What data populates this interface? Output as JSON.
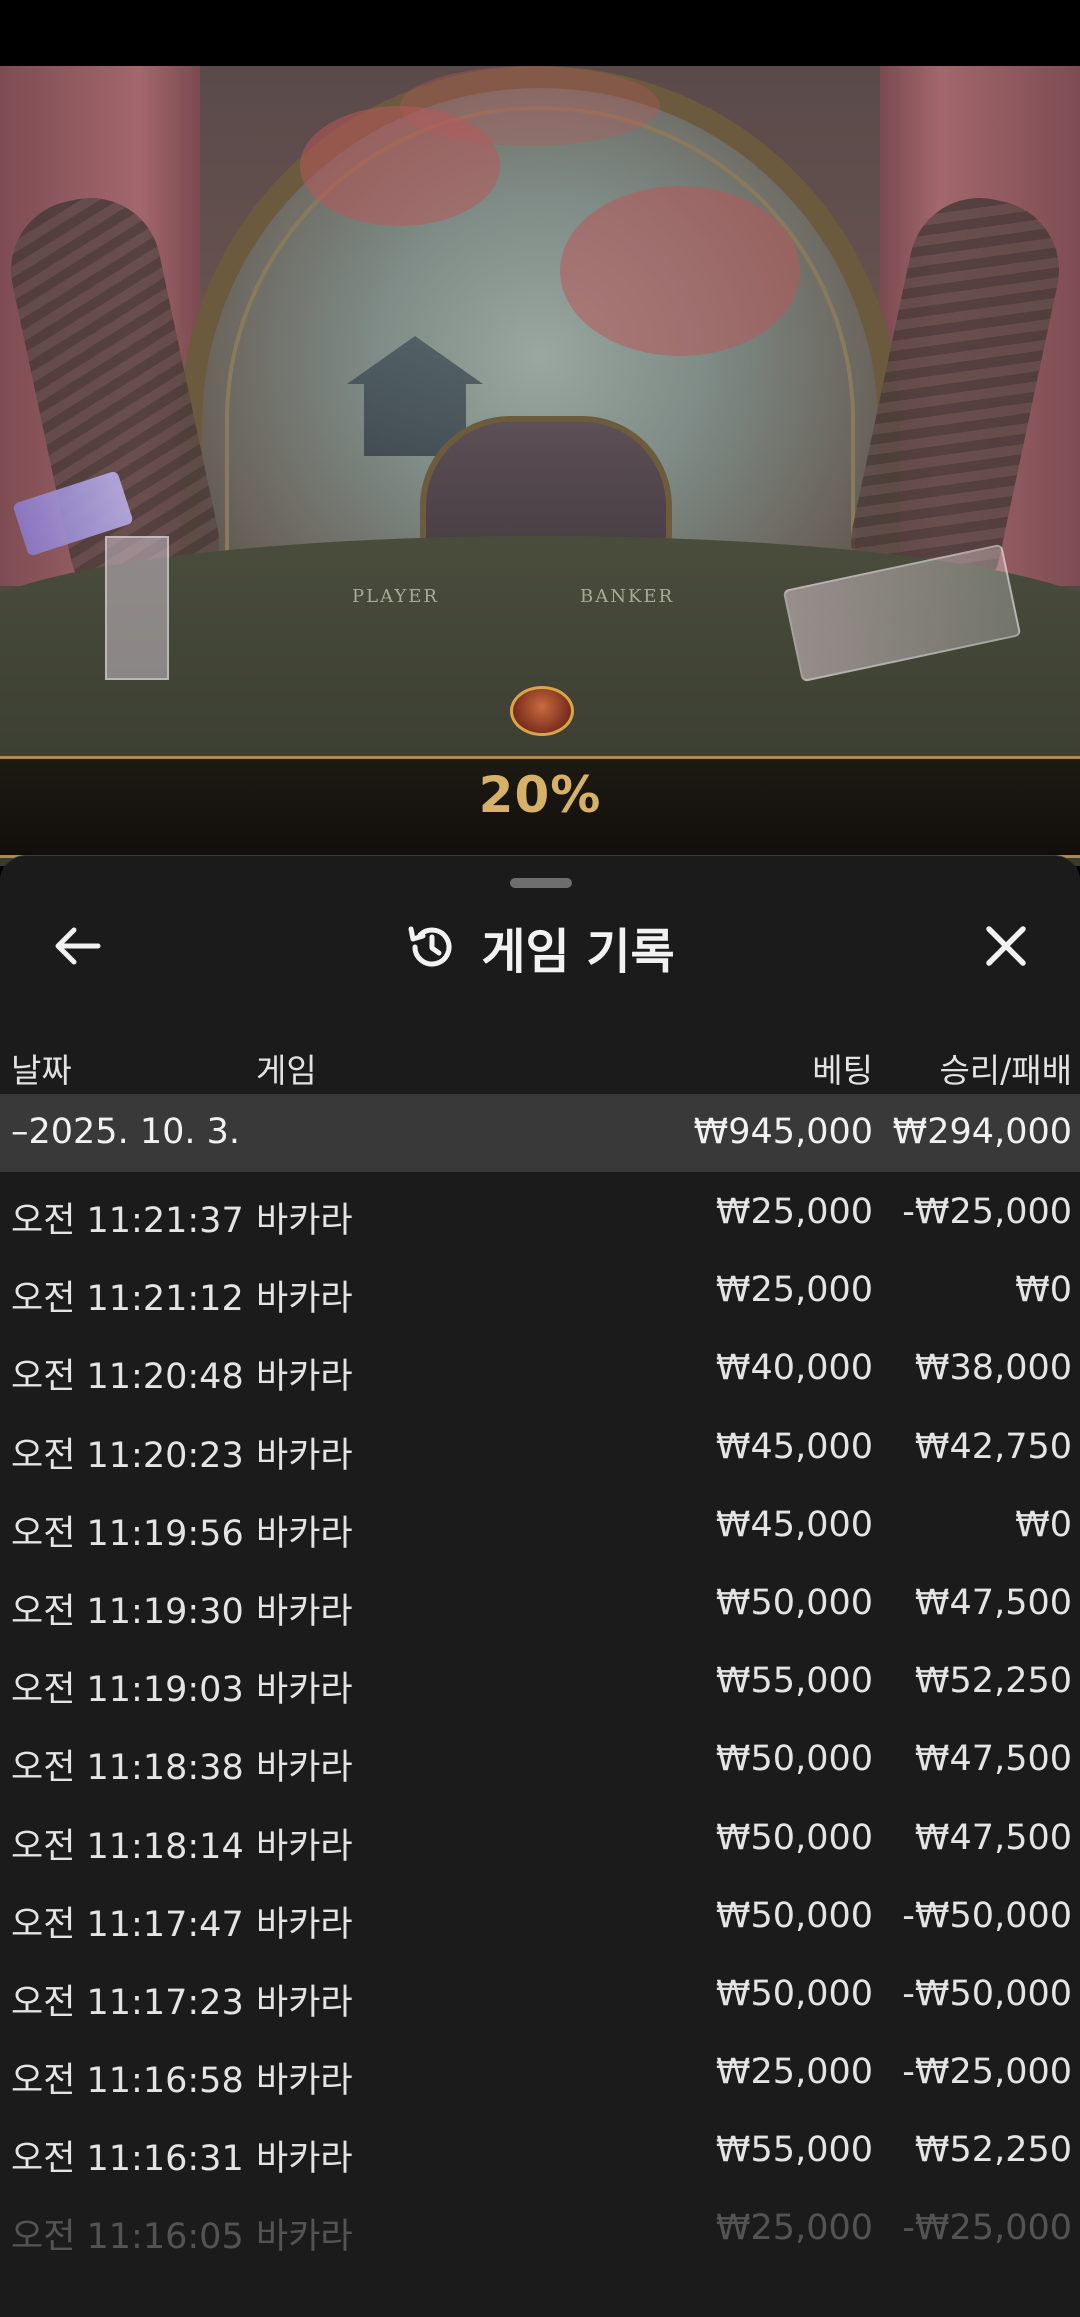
{
  "video": {
    "table_labels": [
      "PLAYER",
      "BANKER"
    ],
    "progress_text": "20%"
  },
  "sheet": {
    "title": "게임 기록",
    "columns": {
      "date": "날짜",
      "game": "게임",
      "bet": "베팅",
      "result": "승리/패배"
    },
    "group": {
      "date": "–2025. 10. 3.",
      "bet": "₩945,000",
      "result": "₩294,000"
    },
    "rows": [
      {
        "time": "오전 11:21:37",
        "game": "바카라",
        "bet": "₩25,000",
        "result": "-₩25,000"
      },
      {
        "time": "오전 11:21:12",
        "game": "바카라",
        "bet": "₩25,000",
        "result": "₩0"
      },
      {
        "time": "오전 11:20:48",
        "game": "바카라",
        "bet": "₩40,000",
        "result": "₩38,000"
      },
      {
        "time": "오전 11:20:23",
        "game": "바카라",
        "bet": "₩45,000",
        "result": "₩42,750"
      },
      {
        "time": "오전 11:19:56",
        "game": "바카라",
        "bet": "₩45,000",
        "result": "₩0"
      },
      {
        "time": "오전 11:19:30",
        "game": "바카라",
        "bet": "₩50,000",
        "result": "₩47,500"
      },
      {
        "time": "오전 11:19:03",
        "game": "바카라",
        "bet": "₩55,000",
        "result": "₩52,250"
      },
      {
        "time": "오전 11:18:38",
        "game": "바카라",
        "bet": "₩50,000",
        "result": "₩47,500"
      },
      {
        "time": "오전 11:18:14",
        "game": "바카라",
        "bet": "₩50,000",
        "result": "₩47,500"
      },
      {
        "time": "오전 11:17:47",
        "game": "바카라",
        "bet": "₩50,000",
        "result": "-₩50,000"
      },
      {
        "time": "오전 11:17:23",
        "game": "바카라",
        "bet": "₩50,000",
        "result": "-₩50,000"
      },
      {
        "time": "오전 11:16:58",
        "game": "바카라",
        "bet": "₩25,000",
        "result": "-₩25,000"
      },
      {
        "time": "오전 11:16:31",
        "game": "바카라",
        "bet": "₩55,000",
        "result": "₩52,250"
      },
      {
        "time": "오전 11:16:05",
        "game": "바카라",
        "bet": "₩25,000",
        "result": "-₩25,000"
      }
    ]
  },
  "icons": {
    "back": "arrow-left-icon",
    "history": "history-icon",
    "close": "close-icon"
  },
  "colors": {
    "sheet_bg": "#1b1b1b",
    "group_bg": "#393939",
    "accent_gold": "#d7b06a"
  }
}
